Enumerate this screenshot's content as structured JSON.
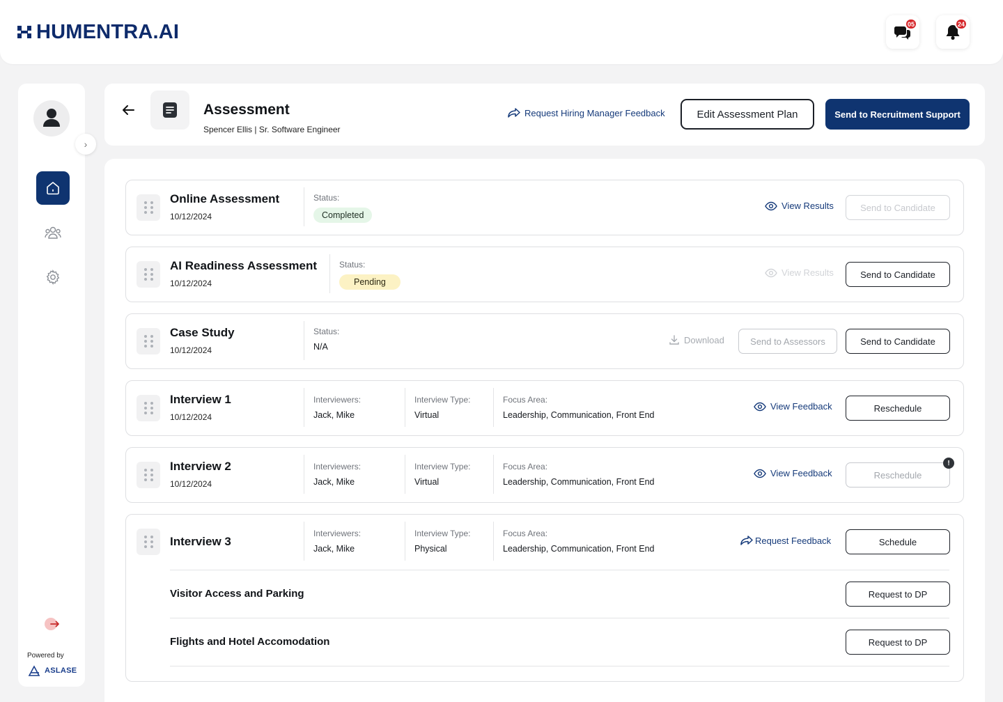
{
  "brand": {
    "name": "HUMENTRA.AI"
  },
  "header": {
    "messages_badge": "05",
    "notifications_badge": "24"
  },
  "sidebar": {
    "powered_by": "Powered by",
    "partner": "ASLASE",
    "items": [
      {
        "icon": "home-icon",
        "active": true
      },
      {
        "icon": "users-icon",
        "active": false
      },
      {
        "icon": "gear-icon",
        "active": false
      }
    ]
  },
  "page": {
    "title": "Assessment",
    "subtitle": "Spencer Ellis | Sr. Software Engineer",
    "request_hm_feedback": "Request Hiring Manager Feedback",
    "edit_plan": "Edit Assessment Plan",
    "send_recruitment": "Send to Recruitment Support"
  },
  "labels": {
    "status": "Status:",
    "interviewers": "Interviewers:",
    "interview_type": "Interview Type:",
    "focus_area": "Focus Area:"
  },
  "rows": [
    {
      "title": "Online Assessment",
      "date": "10/12/2024",
      "status": "Completed",
      "link": "View Results",
      "button": "Send to Candidate"
    },
    {
      "title": "AI Readiness Assessment",
      "date": "10/12/2024",
      "status": "Pending",
      "link": "View Results",
      "button": "Send to Candidate"
    },
    {
      "title": "Case Study",
      "date": "10/12/2024",
      "status": "N/A",
      "link": "Download",
      "button2": "Send to Assessors",
      "button": "Send to Candidate"
    },
    {
      "title": "Interview 1",
      "date": "10/12/2024",
      "interviewers": "Jack, Mike",
      "type": "Virtual",
      "focus": "Leadership, Communication, Front End",
      "link": "View Feedback",
      "button": "Reschedule"
    },
    {
      "title": "Interview 2",
      "date": "10/12/2024",
      "interviewers": "Jack, Mike",
      "type": "Virtual",
      "focus": "Leadership, Communication, Front End",
      "link": "View Feedback",
      "button": "Reschedule",
      "alert": "!"
    },
    {
      "title": "Interview 3",
      "interviewers": "Jack, Mike",
      "type": "Physical",
      "focus": "Leadership, Communication, Front End",
      "link": "Request Feedback",
      "button": "Schedule",
      "sub_items": [
        {
          "title": "Visitor Access and Parking",
          "button": "Request to DP"
        },
        {
          "title": "Flights and Hotel Accomodation",
          "button": "Request to DP"
        }
      ]
    }
  ],
  "colors": {
    "brand": "#0e2b6b",
    "primary": "#0f3470",
    "completed_bg": "#e5f6e8",
    "pending_bg": "#fcf2c4",
    "badge": "#d6272b"
  }
}
